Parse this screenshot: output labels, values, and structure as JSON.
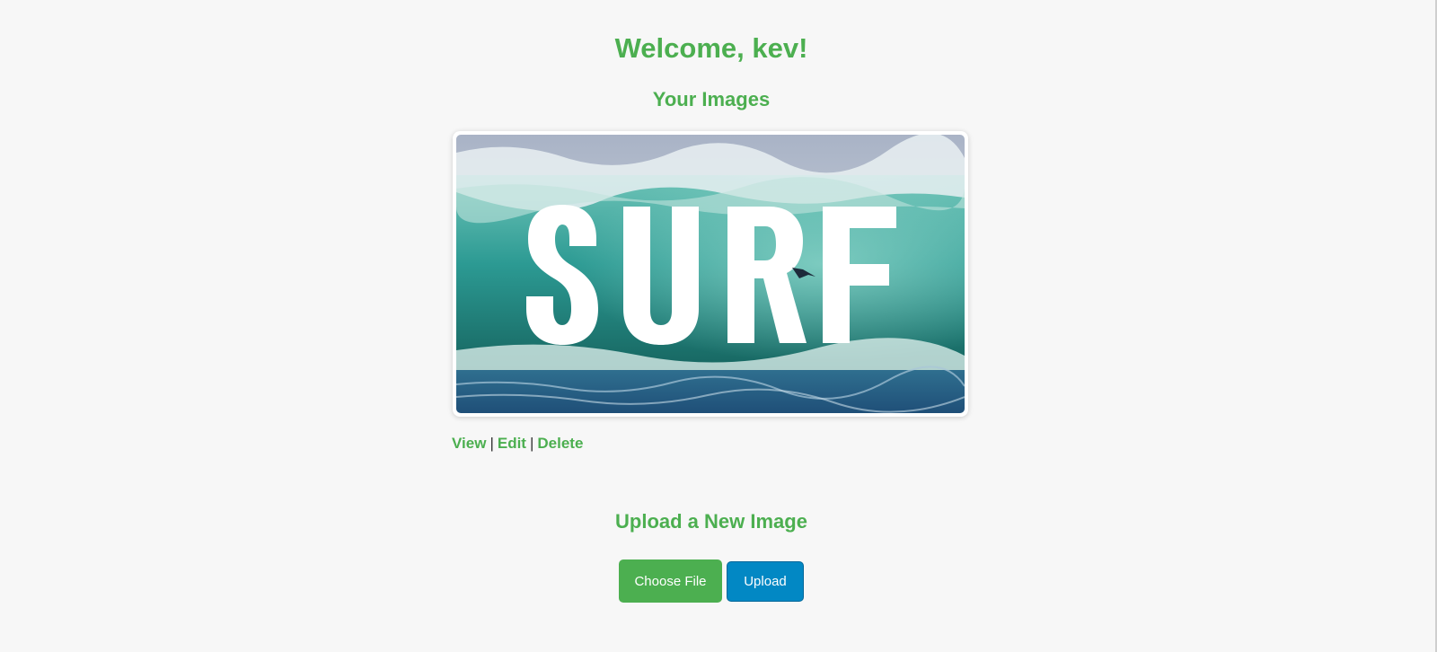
{
  "header": {
    "welcome": "Welcome, kev!"
  },
  "gallery": {
    "heading": "Your Images",
    "image": {
      "overlay_text": "SURF",
      "alt": "surf wave image"
    },
    "actions": {
      "view": "View",
      "edit": "Edit",
      "delete": "Delete",
      "separator": "|"
    }
  },
  "upload": {
    "heading": "Upload a New Image",
    "choose_label": "Choose File",
    "upload_label": "Upload"
  },
  "colors": {
    "accent_green": "#4caf50",
    "upload_blue": "#0288c4",
    "background": "#f7f7f7"
  }
}
